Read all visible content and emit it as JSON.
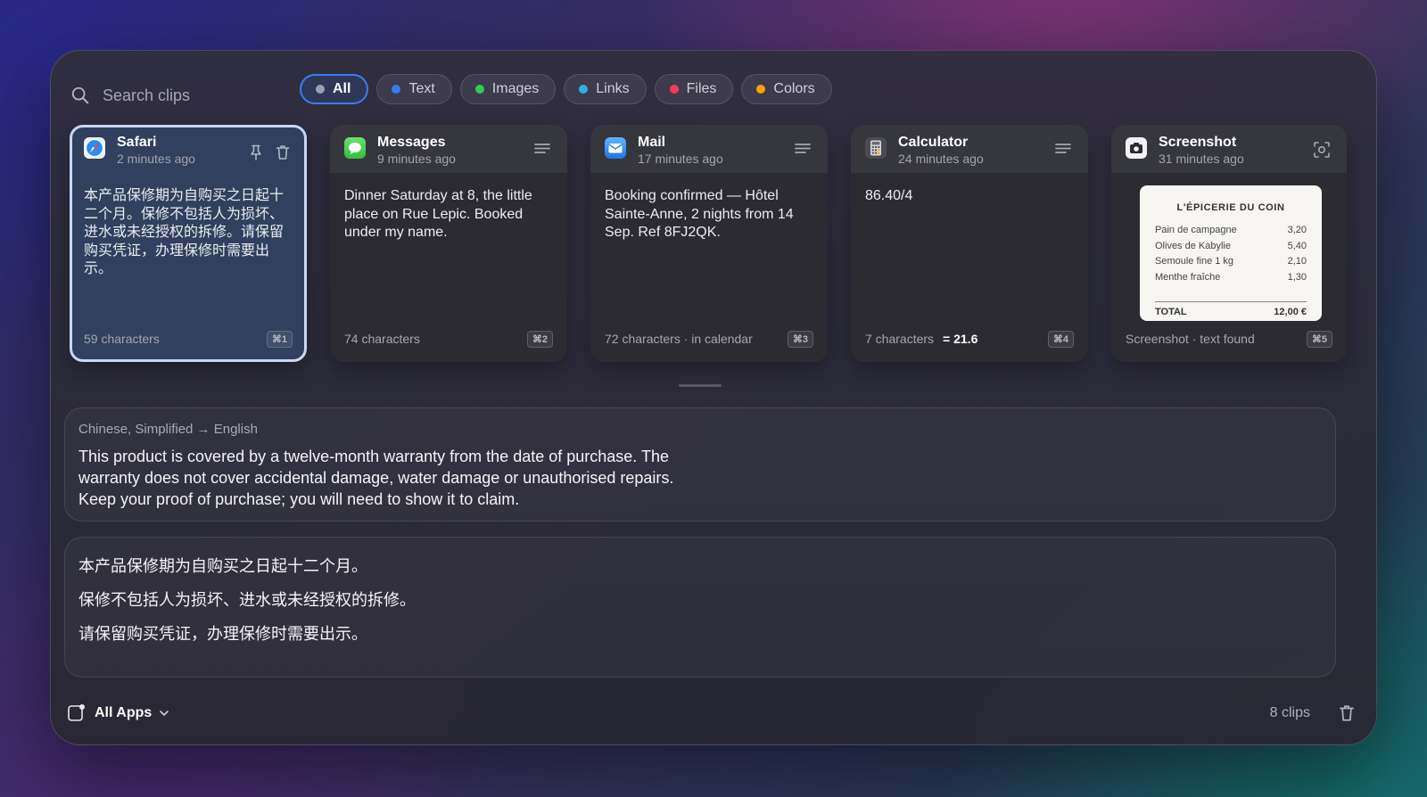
{
  "search": {
    "placeholder": "Search clips"
  },
  "filters": [
    {
      "label": "All",
      "color": "#9aa0ad",
      "active": true
    },
    {
      "label": "Text",
      "color": "#2f7ef6"
    },
    {
      "label": "Images",
      "color": "#34c759"
    },
    {
      "label": "Links",
      "color": "#32ade6"
    },
    {
      "label": "Files",
      "color": "#ff375f"
    },
    {
      "label": "Colors",
      "color": "#ff9f0a"
    }
  ],
  "clips": [
    {
      "app": "Safari",
      "time": "2 minutes ago",
      "icon": "safari-icon",
      "content": "本产品保修期为自购买之日起十二个月。保修不包括人为损坏、进水或未经授权的拆修。请保留购买凭证，办理保修时需要出示。",
      "meta": "59 characters",
      "shortcut": "⌘1",
      "selected": true
    },
    {
      "app": "Messages",
      "time": "9 minutes ago",
      "icon": "messages-icon",
      "content": "Dinner Saturday at 8, the little place on Rue Lepic. Booked under my name.",
      "meta": "74 characters",
      "shortcut": "⌘2"
    },
    {
      "app": "Mail",
      "time": "17 minutes ago",
      "icon": "mail-icon",
      "content": "Booking confirmed — Hôtel Sainte-Anne, 2 nights from 14 Sep. Ref 8FJ2QK.",
      "meta": "72 characters · in calendar",
      "shortcut": "⌘3"
    },
    {
      "app": "Calculator",
      "time": "24 minutes ago",
      "icon": "calculator-icon",
      "content": "86.40/4",
      "meta": "7 characters",
      "result": "= 21.6",
      "shortcut": "⌘4"
    },
    {
      "app": "Screenshot",
      "time": "31 minutes ago",
      "icon": "screenshot-icon",
      "meta": "Screenshot · text found",
      "shortcut": "⌘5",
      "receipt": {
        "title": "L'ÉPICERIE DU COIN",
        "items": [
          {
            "name": "Pain de campagne",
            "price": "3,20"
          },
          {
            "name": "Olives de Kabylie",
            "price": "5,40"
          },
          {
            "name": "Semoule fine 1 kg",
            "price": "2,10"
          },
          {
            "name": "Menthe fraîche",
            "price": "1,30"
          }
        ],
        "total_label": "TOTAL",
        "total_value": "12,00 €"
      }
    }
  ],
  "translation": {
    "label": "Chinese, Simplified → English",
    "text": "This product is covered by a twelve-month warranty from the date of purchase. The warranty does not cover accidental damage, water damage or unauthorised repairs. Keep your proof of purchase; you will need to show it to claim."
  },
  "source": {
    "lines": [
      "本产品保修期为自购买之日起十二个月。",
      "保修不包括人为损坏、进水或未经授权的拆修。",
      "请保留购买凭证，办理保修时需要出示。"
    ]
  },
  "footer": {
    "apps_label": "All Apps",
    "clip_count": "8 clips"
  }
}
